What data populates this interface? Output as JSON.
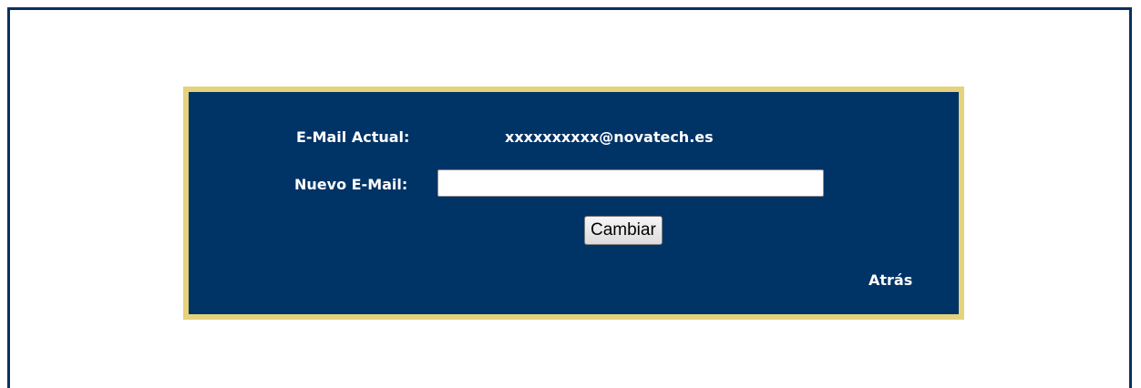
{
  "form": {
    "current_email_label": "E-Mail Actual:",
    "current_email_value": "xxxxxxxxxx@novatech.es",
    "new_email_label": "Nuevo E-Mail:",
    "new_email_value": "",
    "new_email_placeholder": "",
    "submit_label": "Cambiar",
    "back_link_label": "Atrás"
  },
  "colors": {
    "frame_border": "#0c2f5e",
    "panel_background": "#003366",
    "panel_border": "#e5d27c",
    "text": "#ffffff"
  }
}
